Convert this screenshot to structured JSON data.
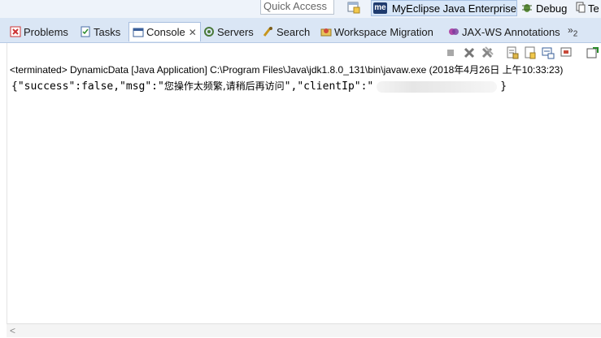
{
  "toolbar": {
    "quick_access_placeholder": "Quick Access",
    "perspectives": {
      "myeclipse": "MyEclipse Java Enterprise",
      "myeclipse_badge": "me",
      "debug": "Debug",
      "te_partial": "Te"
    }
  },
  "tabs": [
    {
      "label": "Problems",
      "icon": "problems-icon"
    },
    {
      "label": "Tasks",
      "icon": "tasks-icon"
    },
    {
      "label": "Console",
      "icon": "console-icon",
      "close": "✕"
    },
    {
      "label": "Servers",
      "icon": "servers-icon"
    },
    {
      "label": "Search",
      "icon": "search-icon"
    },
    {
      "label": "Workspace Migration",
      "icon": "migration-icon"
    },
    {
      "label": "JAX-WS Annotations",
      "icon": "jaxws-icon"
    }
  ],
  "tab_overflow": {
    "symbol": "»",
    "count": "2"
  },
  "console": {
    "header": "<terminated> DynamicData [Java Application] C:\\Program Files\\Java\\jdk1.8.0_131\\bin\\javaw.exe (2018年4月26日 上午10:33:23)",
    "output_prefix": "{\"success\":false,\"msg\":\"",
    "output_msg": "您操作太频繁,请稍后再访问",
    "output_mid": "\",\"clientIp\":\"",
    "output_suffix": "}"
  },
  "colors": {
    "tabbar_bg": "#dae6f5",
    "active_persp_bg": "#d7e6f8",
    "toolbar_bg": "#eef3fa"
  }
}
